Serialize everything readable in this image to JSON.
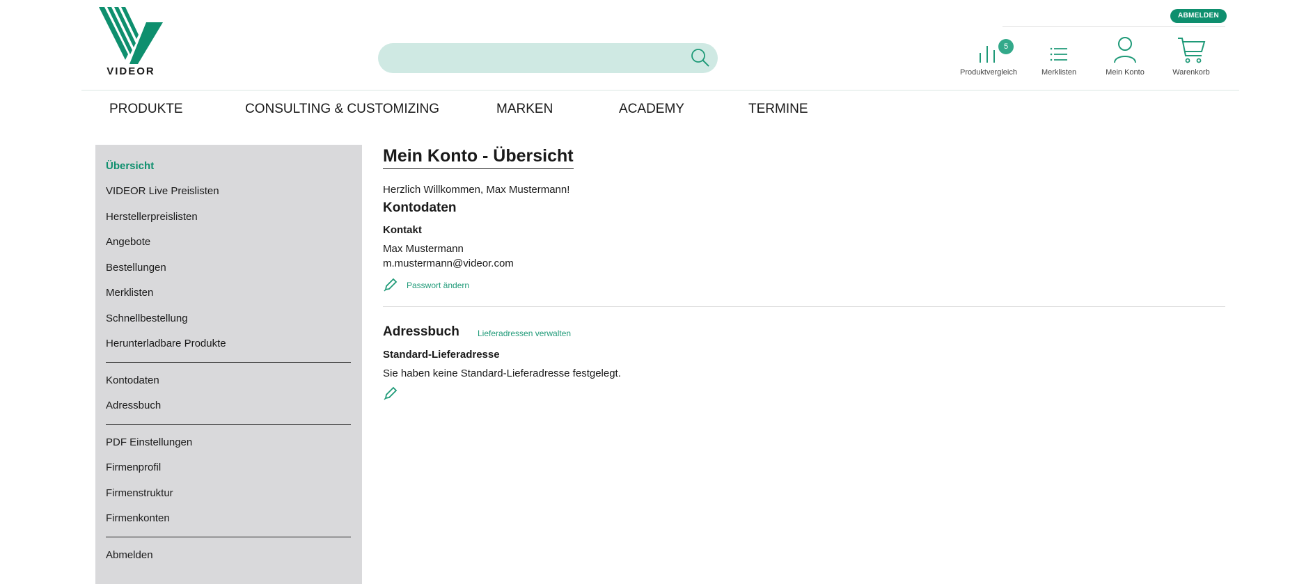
{
  "header": {
    "logo_text": "VIDEOR",
    "search": {
      "value": "",
      "placeholder": ""
    },
    "logout_label": "ABMELDEN",
    "icons": {
      "compare": {
        "label": "Produktvergleich",
        "badge": "5"
      },
      "lists": {
        "label": "Merklisten"
      },
      "account": {
        "label": "Mein Konto"
      },
      "cart": {
        "label": "Warenkorb"
      }
    }
  },
  "nav": {
    "items": [
      "PRODUKTE",
      "CONSULTING & CUSTOMIZING",
      "MARKEN",
      "ACADEMY",
      "TERMINE"
    ]
  },
  "sidebar": {
    "group1": [
      "Übersicht",
      "VIDEOR Live Preislisten",
      "Herstellerpreislisten",
      "Angebote",
      "Bestellungen",
      "Merklisten",
      "Schnellbestellung",
      "Herunterladbare Produkte"
    ],
    "group2": [
      "Kontodaten",
      "Adressbuch"
    ],
    "group3": [
      "PDF Einstellungen",
      "Firmenprofil",
      "Firmenstruktur",
      "Firmenkonten"
    ],
    "group4": [
      "Abmelden"
    ]
  },
  "content": {
    "title": "Mein Konto - Übersicht",
    "welcome": "Herzlich Willkommen, Max Mustermann!",
    "account_heading": "Kontodaten",
    "contact_heading": "Kontakt",
    "contact_name": "Max Mustermann",
    "contact_email": "m.mustermann@videor.com",
    "change_password": "Passwort ändern",
    "addressbook_heading": "Adressbuch",
    "manage_addresses": "Lieferadressen verwalten",
    "default_shipping_heading": "Standard-Lieferadresse",
    "default_shipping_text": "Sie haben keine Standard-Lieferadresse festgelegt."
  },
  "colors": {
    "brand": "#0e8f6e",
    "search_bg": "#cfe9e3",
    "sidebar_bg": "#d9d9db"
  }
}
